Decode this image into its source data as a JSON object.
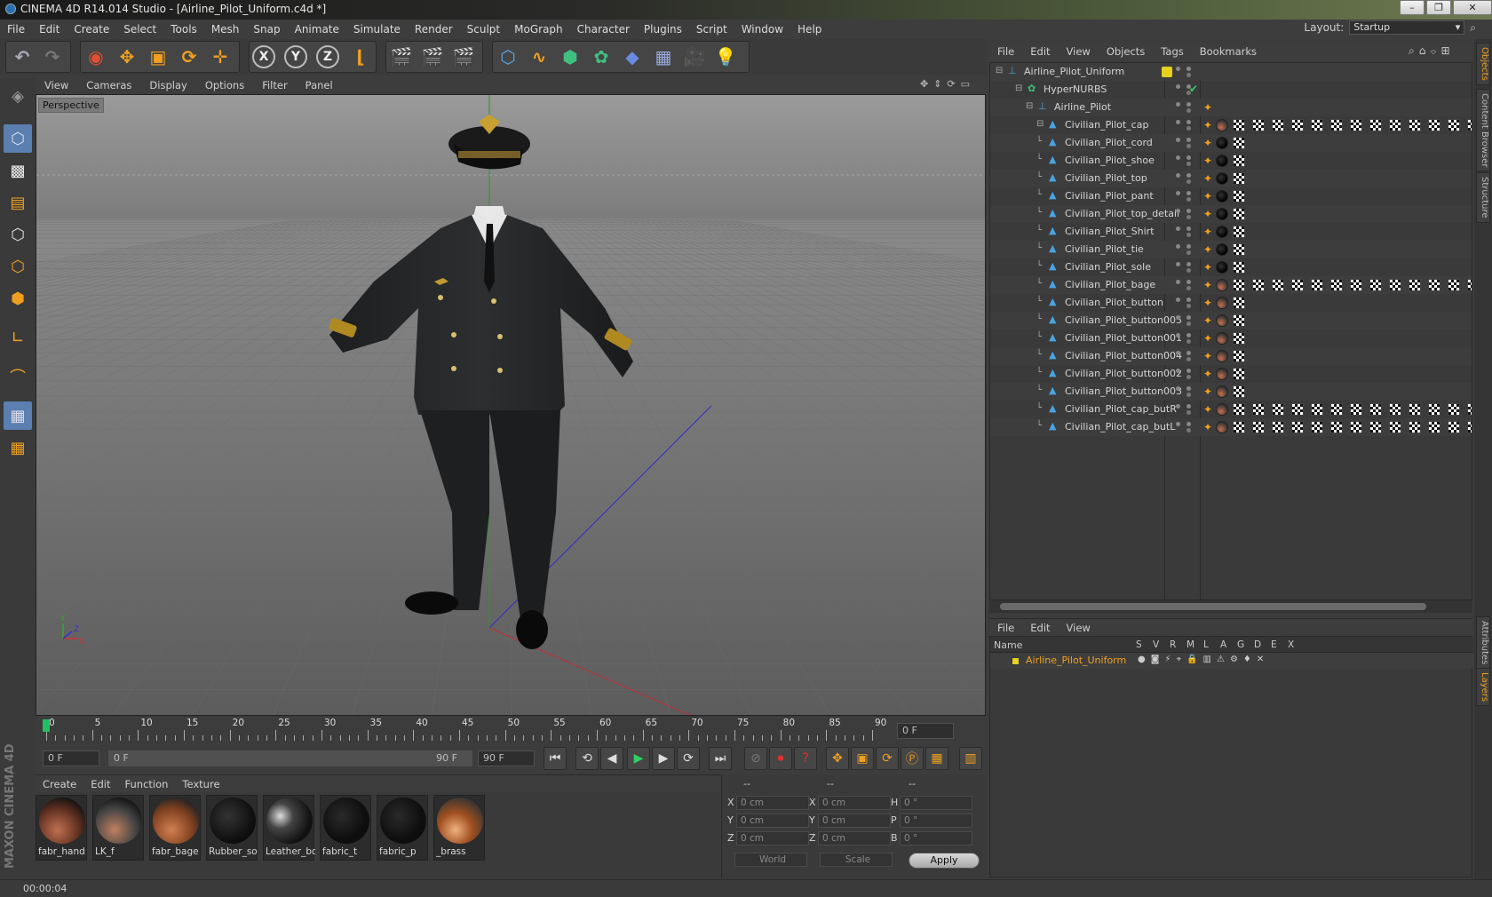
{
  "window": {
    "title": "CINEMA 4D R14.014 Studio - [Airline_Pilot_Uniform.c4d *]"
  },
  "menu": [
    "File",
    "Edit",
    "Create",
    "Select",
    "Tools",
    "Mesh",
    "Snap",
    "Animate",
    "Simulate",
    "Render",
    "Sculpt",
    "MoGraph",
    "Character",
    "Plugins",
    "Script",
    "Window",
    "Help"
  ],
  "layout": {
    "label": "Layout:",
    "value": "Startup"
  },
  "viewport": {
    "menu": [
      "View",
      "Cameras",
      "Display",
      "Options",
      "Filter",
      "Panel"
    ],
    "label": "Perspective"
  },
  "timeline": {
    "ticks": [
      "0",
      "5",
      "10",
      "15",
      "20",
      "25",
      "30",
      "35",
      "40",
      "45",
      "50",
      "55",
      "60",
      "65",
      "70",
      "75",
      "80",
      "85",
      "90"
    ],
    "current_frame": "0 F",
    "start_field": "0 F",
    "range_start": "0 F",
    "range_end": "90 F",
    "end_field": "90 F"
  },
  "materials": {
    "menu": [
      "Create",
      "Edit",
      "Function",
      "Texture"
    ],
    "items": [
      "fabr_hand",
      "LK_f",
      "fabr_bage",
      "Rubber_so",
      "Leather_bo",
      "fabric_t",
      "fabric_p",
      "_brass"
    ]
  },
  "coords": {
    "headers": [
      "--",
      "--",
      "--"
    ],
    "pos_labels": [
      "X",
      "Y",
      "Z"
    ],
    "size_labels": [
      "X",
      "Y",
      "Z"
    ],
    "rot_labels": [
      "H",
      "P",
      "B"
    ],
    "pos_values": [
      "0 cm",
      "0 cm",
      "0 cm"
    ],
    "size_values": [
      "0 cm",
      "0 cm",
      "0 cm"
    ],
    "rot_values": [
      "0 °",
      "0 °",
      "0 °"
    ],
    "mode_world": "World",
    "mode_scale": "Scale",
    "apply": "Apply"
  },
  "status": {
    "time": "00:00:04"
  },
  "objects": {
    "menu": [
      "File",
      "Edit",
      "View",
      "Objects",
      "Tags",
      "Bookmarks"
    ],
    "root": "Airline_Pilot_Uniform",
    "hypernurbs": "HyperNURBS",
    "group": "Airline_Pilot",
    "children": [
      "Civilian_Pilot_cap",
      "Civilian_Pilot_cord",
      "Civilian_Pilot_shoe",
      "Civilian_Pilot_top",
      "Civilian_Pilot_pant",
      "Civilian_Pilot_top_detail",
      "Civilian_Pilot_Shirt",
      "Civilian_Pilot_tie",
      "Civilian_Pilot_sole",
      "Civilian_Pilot_bage",
      "Civilian_Pilot_button",
      "Civilian_Pilot_button005",
      "Civilian_Pilot_button001",
      "Civilian_Pilot_button004",
      "Civilian_Pilot_button002",
      "Civilian_Pilot_button003",
      "Civilian_Pilot_cap_butR",
      "Civilian_Pilot_cap_butL"
    ]
  },
  "layers": {
    "menu": [
      "File",
      "Edit",
      "View"
    ],
    "col_name": "Name",
    "cols": [
      "S",
      "V",
      "R",
      "M",
      "L",
      "A",
      "G",
      "D",
      "E",
      "X"
    ],
    "row": "Airline_Pilot_Uniform"
  },
  "sidetabs": [
    "Objects",
    "Content Browser",
    "Structure",
    "Attributes",
    "Layers"
  ],
  "brand": "MAXON CINEMA 4D",
  "colors": {
    "accent": "#f0a020",
    "layer_yellow": "#e8d020",
    "icon_blue": "#4aa3e0"
  }
}
